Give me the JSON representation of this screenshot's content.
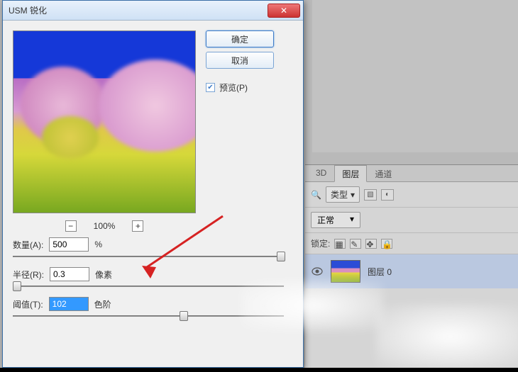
{
  "dialog": {
    "title": "USM 锐化",
    "ok_label": "确定",
    "cancel_label": "取消",
    "preview_label": "预览(P)",
    "zoom_out": "−",
    "zoom_in": "+",
    "zoom_level": "100%",
    "amount": {
      "label": "数量(A):",
      "value": "500",
      "unit": "%"
    },
    "radius": {
      "label": "半径(R):",
      "value": "0.3",
      "unit": "像素"
    },
    "threshold": {
      "label": "阈值(T):",
      "value": "102",
      "unit": "色阶"
    }
  },
  "panels": {
    "tabs": {
      "t3d": "3D",
      "layers": "图层",
      "channels": "通道"
    },
    "kind_label": "类型",
    "blend_mode": "正常",
    "lock_label": "锁定:",
    "layer": {
      "name": "图层 0"
    }
  }
}
